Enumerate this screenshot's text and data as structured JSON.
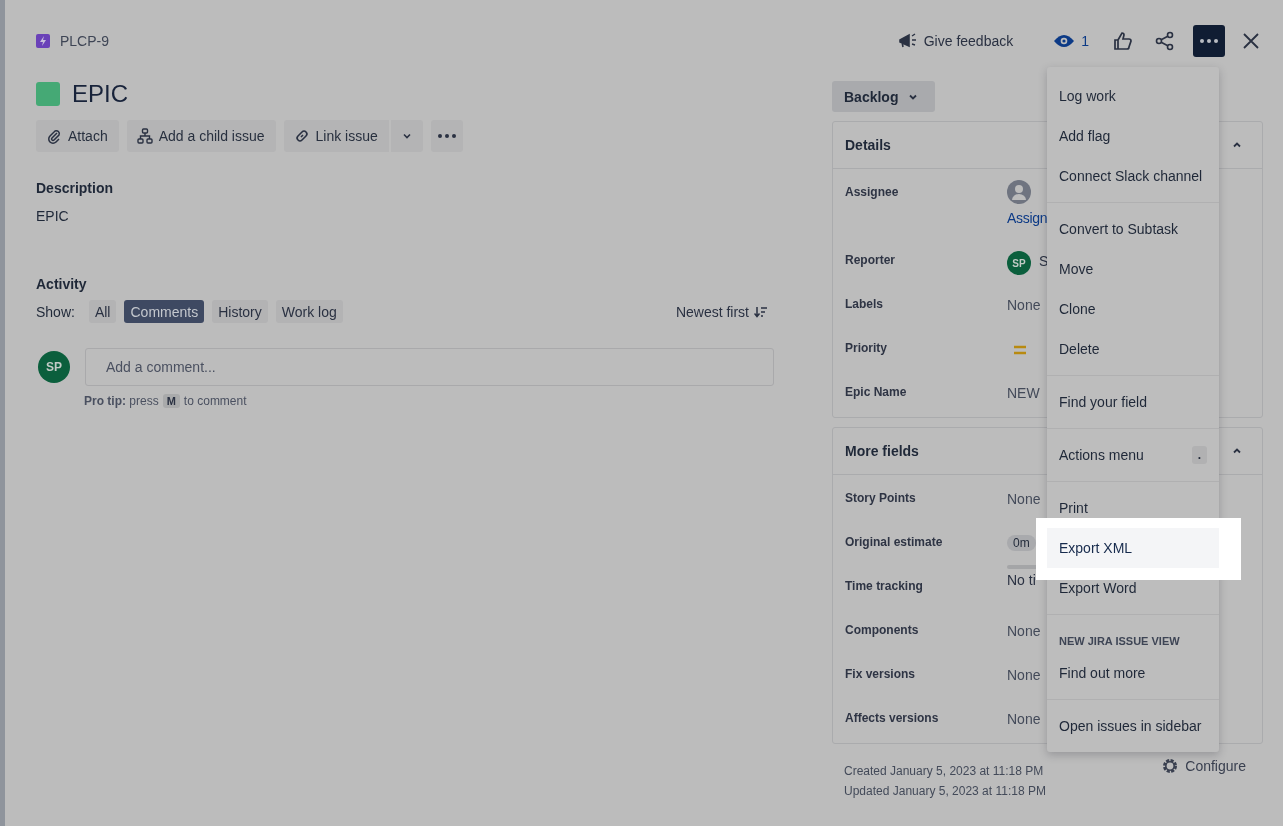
{
  "issue": {
    "key": "PLCP-9",
    "title": "EPIC"
  },
  "toolbar": [
    {
      "label": "Attach",
      "kind": "attach"
    },
    {
      "label": "Add a child issue",
      "kind": "child"
    },
    {
      "label": "Link issue",
      "kind": "split"
    }
  ],
  "description": {
    "heading": "Description",
    "text": "EPIC"
  },
  "activity": {
    "heading": "Activity",
    "show_label": "Show:",
    "filters": [
      {
        "label": "All",
        "selected": false
      },
      {
        "label": "Comments",
        "selected": true
      },
      {
        "label": "History",
        "selected": false
      },
      {
        "label": "Work log",
        "selected": false
      }
    ],
    "sort": "Newest first",
    "comment": {
      "avatar": "SP",
      "placeholder": "Add a comment..."
    },
    "tip": {
      "prefix": "**Pro tip:** press",
      "key": "M",
      "suffix": "to comment"
    }
  },
  "header_actions": {
    "feedback": "Give feedback",
    "watchers": "1",
    "more_expanded": true
  },
  "status": "Backlog",
  "panels": [
    {
      "title": "Details",
      "expanded": true,
      "fields": [
        {
          "label": "Assignee",
          "kind": "user",
          "link": "Assign"
        },
        {
          "label": "Reporter",
          "kind": "initials",
          "avatar": "SP",
          "value": "S"
        },
        {
          "label": "Labels",
          "kind": "text",
          "value": "None"
        },
        {
          "label": "Priority",
          "kind": "priority"
        },
        {
          "label": "Epic Name",
          "kind": "text",
          "value": "NEW"
        }
      ]
    },
    {
      "title": "More fields",
      "expanded": true,
      "fields": [
        {
          "label": "Story Points",
          "kind": "text",
          "value": "None"
        },
        {
          "label": "Original estimate",
          "kind": "badge",
          "value": "0m"
        },
        {
          "label": "Time tracking",
          "kind": "tracking",
          "value": "No ti"
        },
        {
          "label": "Components",
          "kind": "text",
          "value": "None"
        },
        {
          "label": "Fix versions",
          "kind": "text",
          "value": "None"
        },
        {
          "label": "Affects versions",
          "kind": "text",
          "value": "None"
        }
      ]
    }
  ],
  "footer": {
    "created": "Created January 5, 2023 at 11:18 PM",
    "updated": "Updated January 5, 2023 at 11:18 PM",
    "configure": "Configure"
  },
  "menu": [
    [
      {
        "kind": "item",
        "label": "Log work",
        "highlighted": false
      },
      {
        "kind": "item",
        "label": "Add flag",
        "highlighted": false
      },
      {
        "kind": "item",
        "label": "Connect Slack channel",
        "highlighted": false
      }
    ],
    [
      {
        "kind": "item",
        "label": "Convert to Subtask",
        "highlighted": false
      },
      {
        "kind": "item",
        "label": "Move",
        "highlighted": false
      },
      {
        "kind": "item",
        "label": "Clone",
        "highlighted": false
      },
      {
        "kind": "item",
        "label": "Delete",
        "highlighted": false
      }
    ],
    [
      {
        "kind": "item",
        "label": "Find your field",
        "highlighted": false
      }
    ],
    [
      {
        "kind": "shortcut",
        "label": "Actions menu",
        "key": ".",
        "highlighted": false
      }
    ],
    [
      {
        "kind": "item",
        "label": "Print",
        "highlighted": false
      },
      {
        "kind": "item",
        "label": "Export XML",
        "highlighted": true
      },
      {
        "kind": "item",
        "label": "Export Word",
        "highlighted": false
      }
    ],
    [
      {
        "kind": "heading",
        "label": "NEW JIRA ISSUE VIEW"
      },
      {
        "kind": "item",
        "label": "Find out more",
        "highlighted": false
      }
    ],
    [
      {
        "kind": "item",
        "label": "Open issues in sidebar",
        "highlighted": false
      }
    ]
  ]
}
